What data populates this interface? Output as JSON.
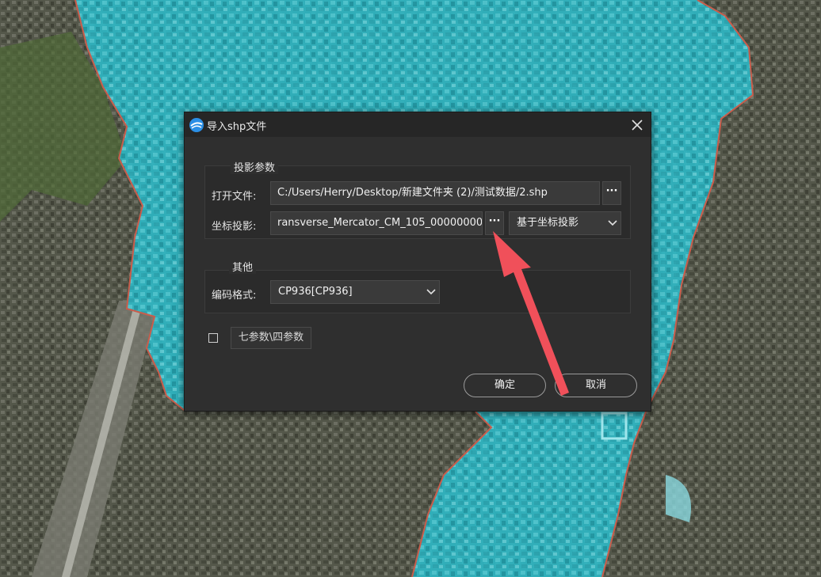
{
  "dialog": {
    "title": "导入shp文件",
    "projection_group": {
      "title": "投影参数",
      "open_file_label": "打开文件:",
      "open_file_value": "C:/Users/Herry/Desktop/新建文件夹 (2)/测试数据/2.shp",
      "coord_label": "坐标投影:",
      "coord_value": "ransverse_Mercator_CM_105_00000000",
      "coord_mode": "基于坐标投影",
      "browse_label": "···"
    },
    "other_group": {
      "title": "其他",
      "encoding_label": "编码格式:",
      "encoding_value": "CP936[CP936]"
    },
    "seven_param_label": "七参数\\四参数",
    "seven_param_checked": false,
    "ok_label": "确定",
    "cancel_label": "取消"
  },
  "colors": {
    "dialog_bg": "#2f2f2f",
    "titlebar_bg": "#262626",
    "annotation_arrow": "#f0505a",
    "map_overlay": "#27b8c6"
  },
  "icons": {
    "app": "app-logo-icon",
    "close": "close-icon",
    "dropdown": "chevron-down-icon",
    "browse": "ellipsis-icon"
  }
}
